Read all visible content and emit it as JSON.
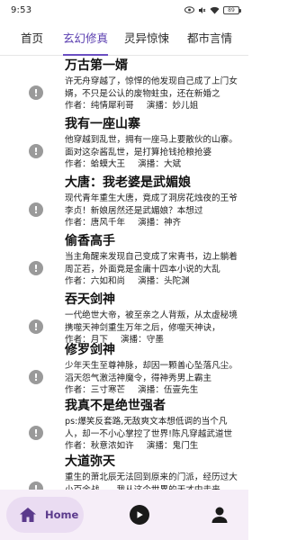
{
  "status_bar": {
    "time": "9:53",
    "battery": "89"
  },
  "tabs": [
    {
      "label": "首页",
      "active": false
    },
    {
      "label": "玄幻修真",
      "active": true
    },
    {
      "label": "灵异惊悚",
      "active": false
    },
    {
      "label": "都市言情",
      "active": false
    }
  ],
  "labels": {
    "author": "作者：",
    "narrator": "演播："
  },
  "books": [
    {
      "title": "万古第一婿",
      "desc": "许无舟穿越了，惊悍的他发现自己成了上门女婿，不只是公认的废物蛀虫，还在新婚之",
      "author": "纯情犀利哥",
      "narrator": "妙儿姐"
    },
    {
      "title": "我有一座山寨",
      "desc": "他穿越到乱世，拥有一座马上要散伙的山寨。面对这杂酱乱世，是打算抢钱抢粮抢婆",
      "author": "蛤蟆大王",
      "narrator": "大斌"
    },
    {
      "title": "大唐：我老婆是武媚娘",
      "desc": "现代青年重生大唐，竟成了洞房花烛夜的王爷李贞！新娘居然还是武媚娘？本想过",
      "author": "唐风千年",
      "narrator": "神齐"
    },
    {
      "title": "偷香高手",
      "desc": "当主角醒来发现自己变成了宋青书，边上躺着周芷若，外面竟是金庸十四本小说的大乱",
      "author": "六如和尚",
      "narrator": "头陀渊"
    },
    {
      "title": "吞天剑神",
      "desc": "一代绝世大帝，被至亲之人背叛，从太虚秘境携噬天神剑重生万年之后，修噬天神诀，",
      "author": "月下",
      "narrator": "守墨"
    },
    {
      "title": "修罗剑神",
      "desc": "少年天生至尊神脉，却因一颗善心坠落凡尘。滔天怨气激活神魔令，得神秀男上霸主",
      "author": "三寸寒芒",
      "narrator": "伍壹先生"
    },
    {
      "title": "我真不是绝世强者",
      "desc": "ps:爆笑反套路,无敌爽文本想低调的当个凡人，却一不小心掌控了世界!陈凡穿越武道世",
      "author": "秋意浓如许",
      "narrator": "鬼门生"
    },
    {
      "title": "大道弥天",
      "desc": "重生的萧北辰无法回到原来的门派，经历过大小百余战……我从这个世界的天才中走来",
      "author": "",
      "narrator": ""
    }
  ],
  "bottom_nav": {
    "home_label": "Home"
  },
  "colors": {
    "accent": "#6a4fc2",
    "nav_bg": "#f6eef8",
    "pill_bg": "#eadcf2"
  }
}
